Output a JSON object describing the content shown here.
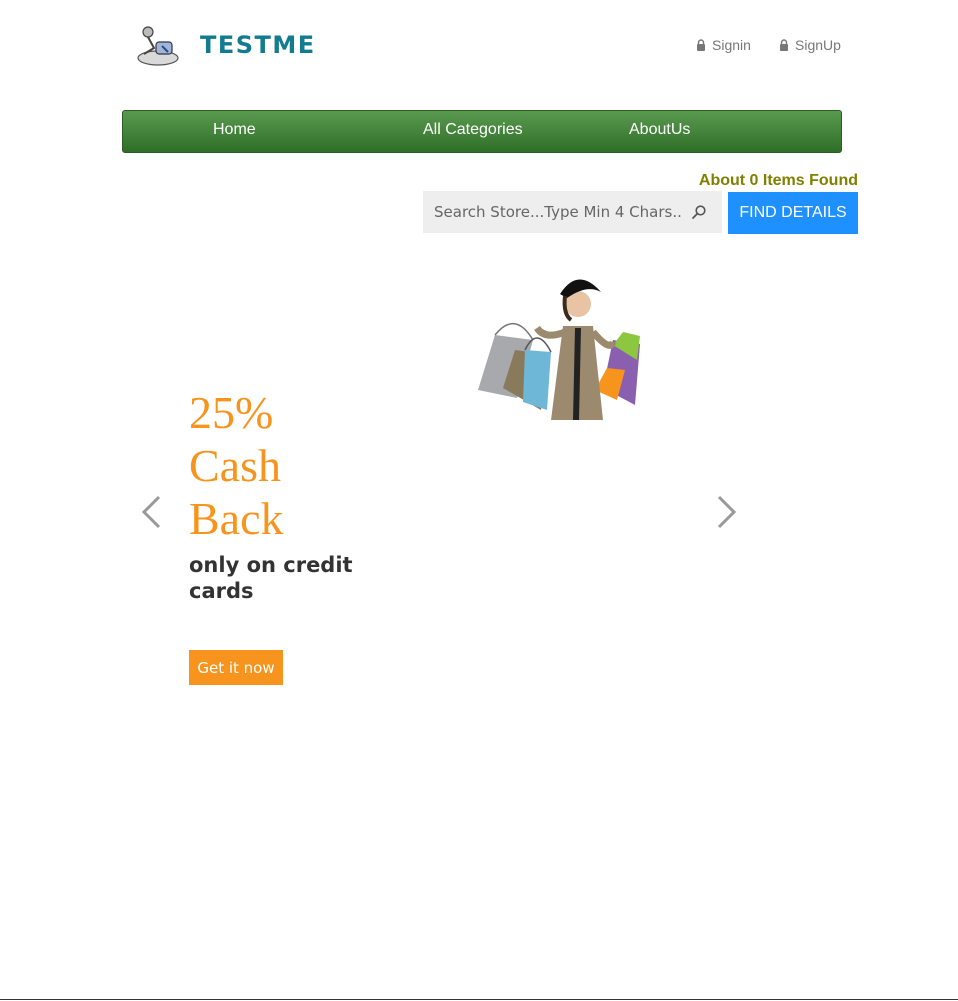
{
  "header": {
    "logo_text": "TESTME",
    "signin_label": "Signin",
    "signup_label": "SignUp"
  },
  "nav": {
    "items": [
      {
        "label": "Home"
      },
      {
        "label": "All Categories"
      },
      {
        "label": "AboutUs"
      }
    ]
  },
  "search": {
    "results_label": "About 0 Items Found",
    "placeholder": "Search Store...Type Min 4 Chars...",
    "button_label": "FIND DETAILS"
  },
  "carousel": {
    "headline_line1": "25%",
    "headline_line2": "Cash",
    "headline_line3": "Back",
    "subline": "only on credit cards",
    "cta_label": "Get it now"
  },
  "colors": {
    "brand": "#127b8f",
    "nav_green": "#3f7f36",
    "search_button": "#1e90ff",
    "accent_orange": "#f7941d",
    "items_found": "#808000"
  },
  "icons": [
    "lock-icon",
    "search-icon",
    "chevron-left-icon",
    "chevron-right-icon"
  ]
}
